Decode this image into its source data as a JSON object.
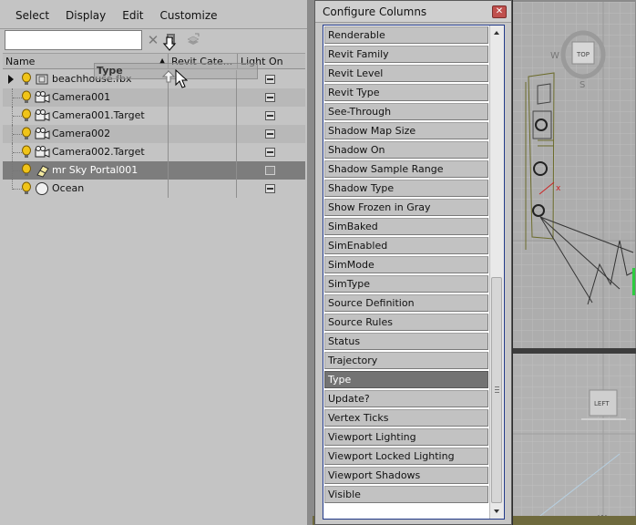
{
  "menu": [
    "Select",
    "Display",
    "Edit",
    "Customize"
  ],
  "search": {
    "value": "",
    "placeholder": ""
  },
  "columns": {
    "name": "Name",
    "revit": "Revit Cate...",
    "light": "Light On"
  },
  "drag_ghost_label": "Type",
  "rows": [
    {
      "label": "beachhouse.fbx",
      "light_on": true,
      "expandable": true
    },
    {
      "label": "Camera001",
      "light_on": true
    },
    {
      "label": "Camera001.Target",
      "light_on": true
    },
    {
      "label": "Camera002",
      "light_on": true
    },
    {
      "label": "Camera002.Target",
      "light_on": true
    },
    {
      "label": "mr Sky Portal001",
      "light_on": false,
      "selected": true
    },
    {
      "label": "Ocean",
      "light_on": true
    }
  ],
  "dialog": {
    "title": "Configure Columns",
    "close_glyph": "✕",
    "items": [
      "Renderable",
      "Revit Family",
      "Revit Level",
      "Revit Type",
      "See-Through",
      "Shadow Map Size",
      "Shadow On",
      "Shadow Sample Range",
      "Shadow Type",
      "Show Frozen in Gray",
      "SimBaked",
      "SimEnabled",
      "SimMode",
      "SimType",
      "Source Definition",
      "Source Rules",
      "Status",
      "Trajectory",
      "Type",
      "Update?",
      "Vertex Ticks",
      "Viewport Lighting",
      "Viewport Locked Lighting",
      "Viewport Shadows",
      "Visible"
    ],
    "selected_item": "Type"
  },
  "viewport": {
    "top_cube_label": "TOP",
    "left_cube_label": "LEFT",
    "compass_w": "W",
    "compass_s": "S",
    "left_axis_w": "W",
    "axis_x": "x"
  },
  "colors": {
    "selection": "#7d7d7d",
    "dialog_border": "#223a8a",
    "close_red": "#c0504d"
  }
}
